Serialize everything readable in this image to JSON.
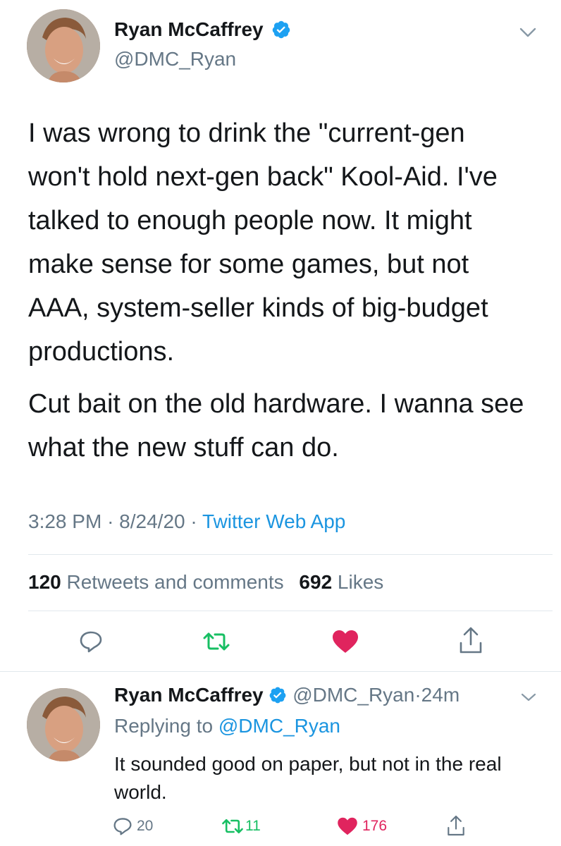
{
  "main_tweet": {
    "author_name": "Ryan McCaffrey",
    "handle": "@DMC_Ryan",
    "paragraphs": [
      "I was wrong to drink the \"current-gen won't hold next-gen back\" Kool-Aid. I've talked to enough people now. It might make sense for some games, but not AAA, system-seller kinds of big-budget productions.",
      "Cut bait on the old hardware. I wanna see what the new stuff can do."
    ],
    "time": "3:28 PM",
    "date": "8/24/20",
    "separator": "·",
    "source": "Twitter Web App",
    "retweets_count": "120",
    "retweets_label": "Retweets and comments",
    "likes_count": "692",
    "likes_label": "Likes"
  },
  "reply_tweet": {
    "author_name": "Ryan McCaffrey",
    "handle": "@DMC_Ryan",
    "age": "24m",
    "replying_prefix": "Replying to",
    "replying_handle": "@DMC_Ryan",
    "text": "It sounded good on paper, but not in the real world.",
    "reply_count": "20",
    "retweet_count": "11",
    "like_count": "176"
  },
  "colors": {
    "verified": "#1da1f2",
    "retweet": "#17bf63",
    "like": "#e0245e",
    "muted": "#657786",
    "link": "#1b95e0"
  },
  "icons": [
    "verified-badge-icon",
    "chevron-down-icon",
    "reply-icon",
    "retweet-icon",
    "heart-icon",
    "share-icon"
  ]
}
